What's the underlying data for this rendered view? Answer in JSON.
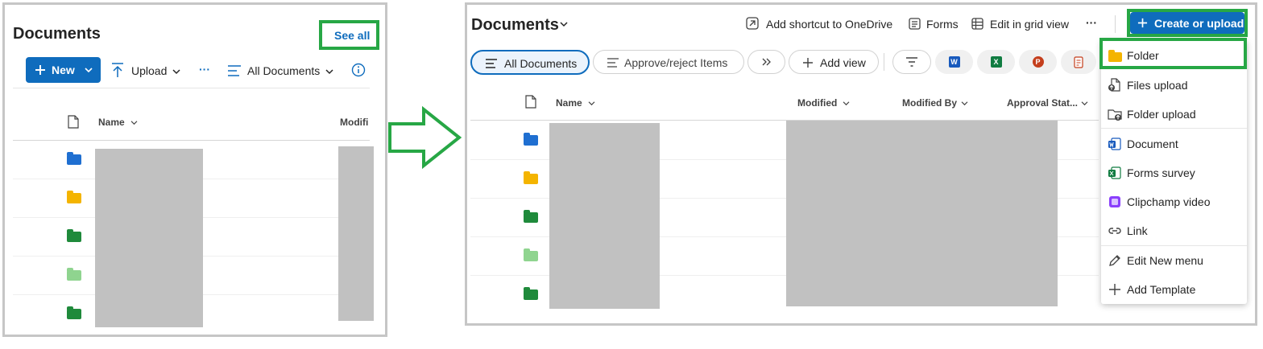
{
  "left": {
    "title": "Documents",
    "see_all": "See all",
    "new_label": "New",
    "upload_label": "Upload",
    "more_label": "···",
    "view_label": "All Documents",
    "col_name": "Name",
    "col_modified": "Modifi",
    "folder_colors": [
      "#1f6fd1",
      "#f4b400",
      "#1f8a3b",
      "#8fd48f",
      "#1f8a3b"
    ]
  },
  "right": {
    "title": "Documents",
    "add_shortcut": "Add shortcut to OneDrive",
    "forms": "Forms",
    "edit_grid": "Edit in grid view",
    "more_label": "···",
    "create_upload": "Create or upload",
    "view_all_docs": "All Documents",
    "view_approve": "Approve/reject Items",
    "add_view": "Add view",
    "col_name": "Name",
    "col_modified": "Modified",
    "col_modified_by": "Modified By",
    "col_approval": "Approval Stat...",
    "folder_colors": [
      "#1f6fd1",
      "#f4b400",
      "#1f8a3b",
      "#8fd48f",
      "#1f8a3b"
    ],
    "menu": {
      "folder": "Folder",
      "files_upload": "Files upload",
      "folder_upload": "Folder upload",
      "document": "Document",
      "forms_survey": "Forms survey",
      "clipchamp": "Clipchamp video",
      "link": "Link",
      "edit_new_menu": "Edit New menu",
      "add_template": "Add Template"
    }
  },
  "colors": {
    "accent": "#0f6cbd",
    "highlight": "#27a745",
    "arrow": "#27a745"
  }
}
